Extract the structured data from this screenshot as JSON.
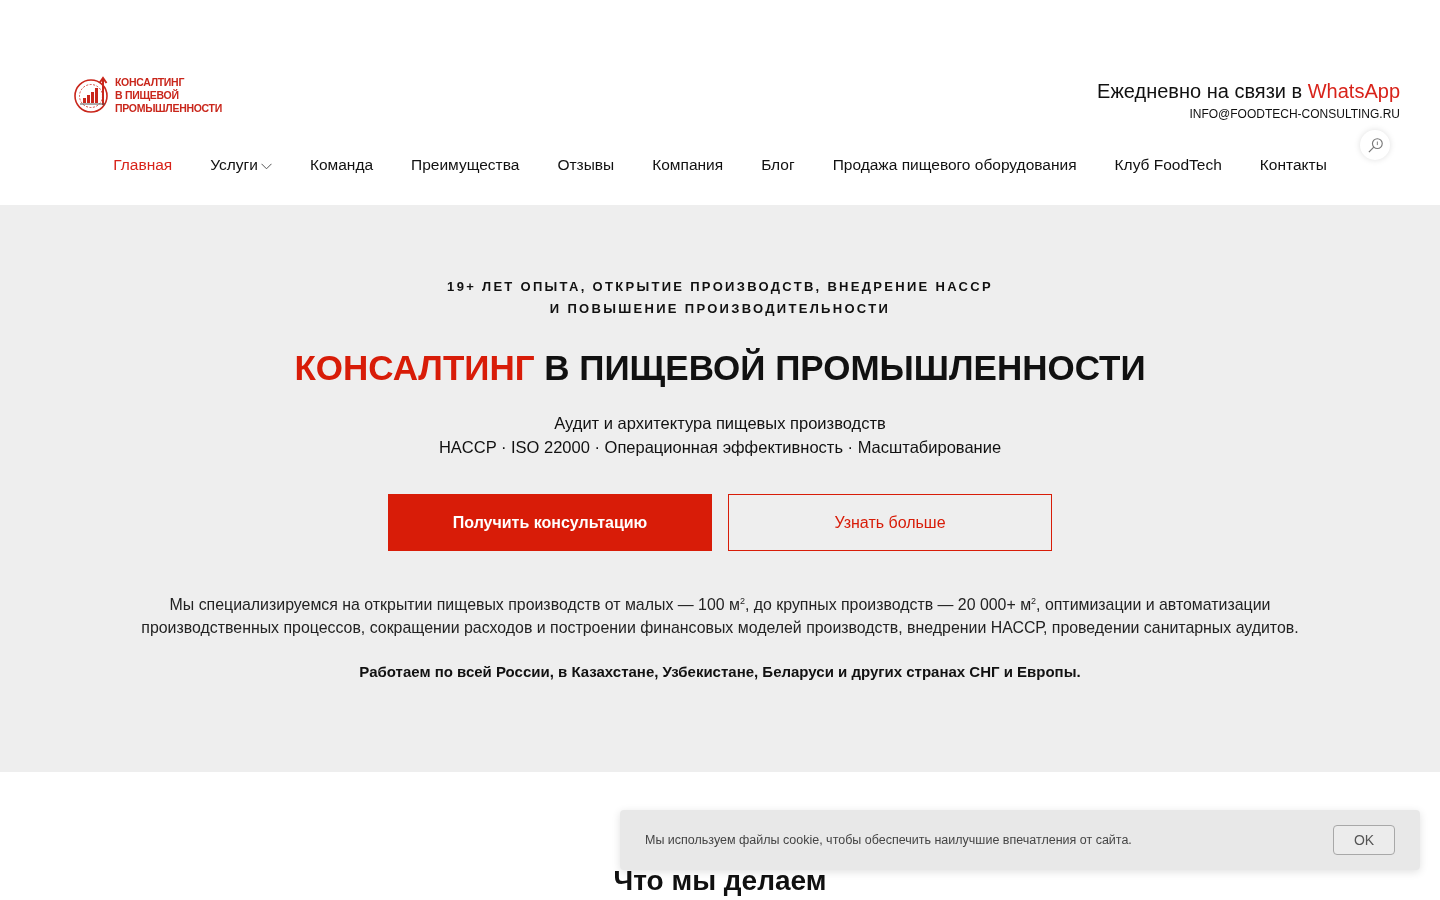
{
  "header": {
    "logo": {
      "lines": [
        "КОНСАЛТИНГ",
        "В ПИЩЕВОЙ",
        "ПРОМЫШЛЕННОСТИ"
      ]
    },
    "contact": {
      "text": "Ежедневно на связи в",
      "link": "WhatsApp"
    },
    "email": "INFO@FOODTECH-CONSULTING.RU",
    "search": {
      "kind": "search"
    }
  },
  "nav": [
    {
      "label": "Главная",
      "selected": true,
      "has_submenu": false
    },
    {
      "label": "Услуги",
      "selected": false,
      "has_submenu": true
    },
    {
      "label": "Команда",
      "selected": false,
      "has_submenu": false
    },
    {
      "label": "Преимущества",
      "selected": false,
      "has_submenu": false
    },
    {
      "label": "Отзывы",
      "selected": false,
      "has_submenu": false
    },
    {
      "label": "Компания",
      "selected": false,
      "has_submenu": false
    },
    {
      "label": "Блог",
      "selected": false,
      "has_submenu": false
    },
    {
      "label": "Продажа пищевого оборудования",
      "selected": false,
      "has_submenu": false
    },
    {
      "label": "Клуб FoodTech",
      "selected": false,
      "has_submenu": false
    },
    {
      "label": "Контакты",
      "selected": false,
      "has_submenu": false
    }
  ],
  "hero": {
    "eyebrow": [
      "19+ ЛЕТ ОПЫТА, ОТКРЫТИЕ ПРОИЗВОДСТВ, ВНЕДРЕНИЕ НАССР",
      "И ПОВЫШЕНИЕ ПРОИЗВОДИТЕЛЬНОСТИ"
    ],
    "title": {
      "accent": "КОНСАЛТИНГ",
      "rest": "В ПИЩЕВОЙ ПРОМЫШЛЕННОСТИ"
    },
    "tagline": [
      "Аудит и архитектура пищевых производств",
      "HACCP · ISO 22000 · Операционная эффективность · Масштабирование"
    ],
    "buttons": [
      {
        "label": "Получить консультацию",
        "kind": "primary"
      },
      {
        "label": "Узнать больше",
        "kind": "outline"
      }
    ],
    "description": "Мы специализируемся на открытии пищевых производств от малых — 100 м$^{2}$, до крупных производств — 20 000+ м$^{2}$, оптимизации и автоматизации производственных процессов, сокращении расходов и построении финансовых моделей производств, внедрении НАССР, проведении санитарных аудитов.",
    "regions": "Работаем по всей России, в Казахстане, Узбекистане, Беларуси и других странах СНГ и Европы."
  },
  "section": {
    "heading": "Что мы делаем"
  },
  "cookie_banner": {
    "text": "Мы используем файлы cookie, чтобы обеспечить наилучшие впечатления от сайта.",
    "button": "OK"
  }
}
